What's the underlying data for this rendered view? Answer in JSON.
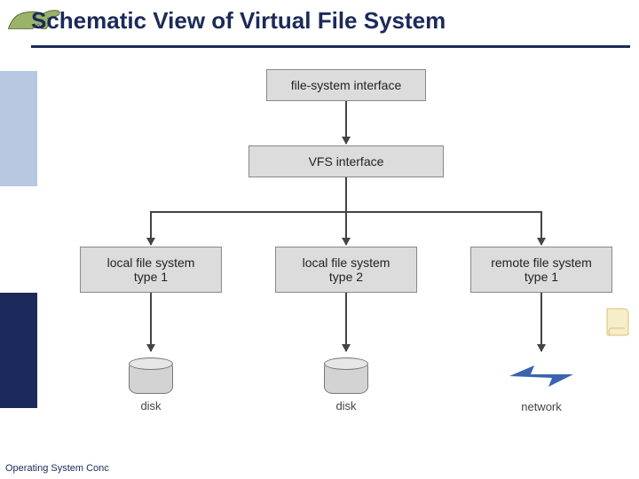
{
  "header": {
    "title": "Schematic View of Virtual File System",
    "logo_name": "dinosaur-icon"
  },
  "sidebar": {
    "top_color": "#b8c8e0",
    "bottom_color": "#1b2a5a"
  },
  "diagram": {
    "nodes": {
      "fs_interface": "file-system interface",
      "vfs_interface": "VFS interface",
      "local_fs_1": "local file system\ntype 1",
      "local_fs_2": "local file system\ntype 2",
      "remote_fs_1": "remote file system\ntype 1",
      "disk_1": "disk",
      "disk_2": "disk",
      "network": "network"
    },
    "edges": [
      [
        "fs_interface",
        "vfs_interface"
      ],
      [
        "vfs_interface",
        "local_fs_1"
      ],
      [
        "vfs_interface",
        "local_fs_2"
      ],
      [
        "vfs_interface",
        "remote_fs_1"
      ],
      [
        "local_fs_1",
        "disk_1"
      ],
      [
        "local_fs_2",
        "disk_2"
      ],
      [
        "remote_fs_1",
        "network"
      ]
    ]
  },
  "footer": {
    "text": "Operating System Conc"
  }
}
